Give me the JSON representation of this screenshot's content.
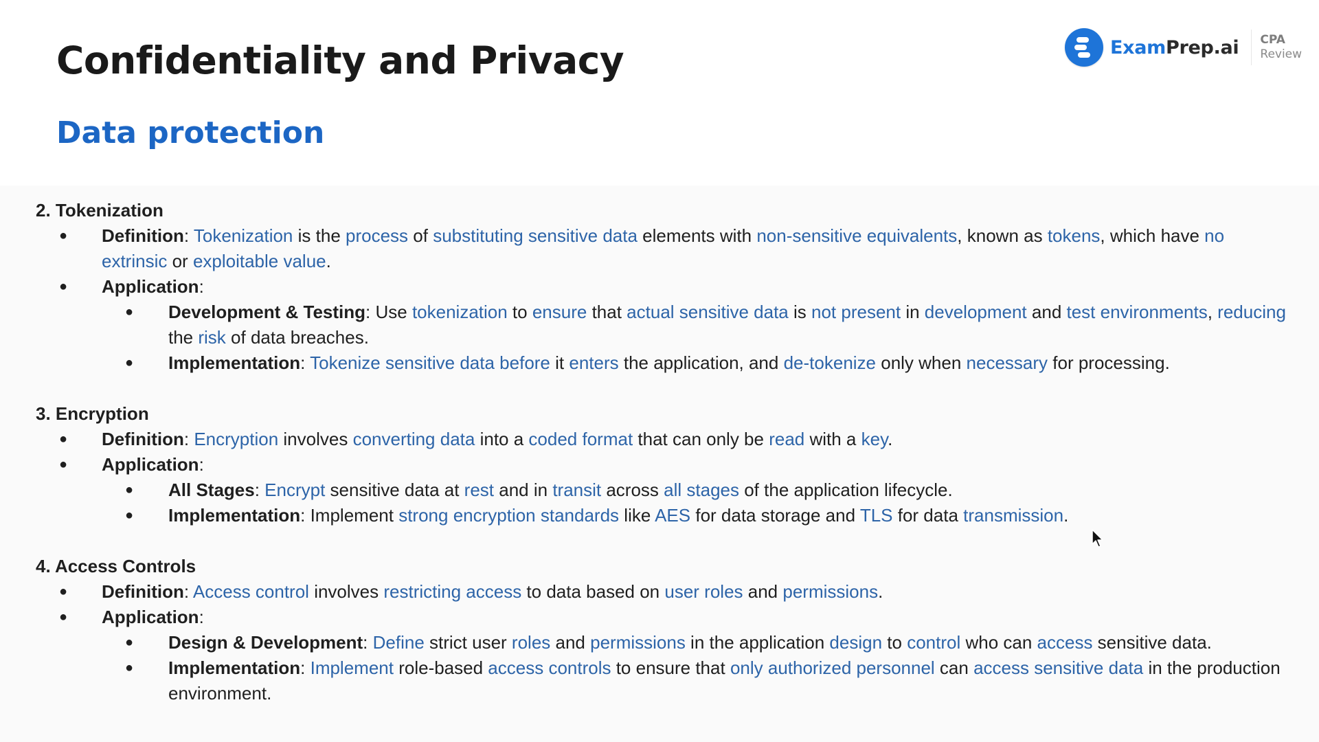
{
  "header": {
    "title": "Confidentiality and Privacy",
    "section": "Data protection"
  },
  "logo": {
    "brand_primary": "Exam",
    "brand_secondary": "Prep.ai",
    "product_line1": "CPA",
    "product_line2": "Review",
    "icon": "exam-prep-logo-icon",
    "brand_color": "#1e74d8"
  },
  "colors": {
    "heading": "#1a1a1a",
    "section_title": "#1c66c4",
    "highlight": "#2d64a8",
    "body_text": "#1f1f1f",
    "content_background": "#fafafa"
  },
  "topics": [
    {
      "heading": "2. Tokenization",
      "items": [
        {
          "label": "Definition",
          "segments": [
            {
              "t": ": ",
              "h": false
            },
            {
              "t": "Tokenization",
              "h": true
            },
            {
              "t": " is the ",
              "h": false
            },
            {
              "t": "process",
              "h": true
            },
            {
              "t": " of ",
              "h": false
            },
            {
              "t": "substituting sensitive data",
              "h": true
            },
            {
              "t": " elements with ",
              "h": false
            },
            {
              "t": "non-sensitive equivalents",
              "h": true
            },
            {
              "t": ", known as ",
              "h": false
            },
            {
              "t": "tokens",
              "h": true
            },
            {
              "t": ", which have ",
              "h": false
            },
            {
              "t": "no extrinsic",
              "h": true
            },
            {
              "t": " or ",
              "h": false
            },
            {
              "t": "exploitable value",
              "h": true
            },
            {
              "t": ".",
              "h": false
            }
          ]
        },
        {
          "label": "Application",
          "segments": [
            {
              "t": ":",
              "h": false
            }
          ],
          "subitems": [
            {
              "label": "Development & Testing",
              "segments": [
                {
                  "t": ": Use ",
                  "h": false
                },
                {
                  "t": "tokenization",
                  "h": true
                },
                {
                  "t": " to ",
                  "h": false
                },
                {
                  "t": "ensure",
                  "h": true
                },
                {
                  "t": " that ",
                  "h": false
                },
                {
                  "t": "actual sensitive data",
                  "h": true
                },
                {
                  "t": " is ",
                  "h": false
                },
                {
                  "t": "not present",
                  "h": true
                },
                {
                  "t": " in ",
                  "h": false
                },
                {
                  "t": "development",
                  "h": true
                },
                {
                  "t": " and ",
                  "h": false
                },
                {
                  "t": "test environments",
                  "h": true
                },
                {
                  "t": ", ",
                  "h": false
                },
                {
                  "t": "reducing",
                  "h": true
                },
                {
                  "t": " the ",
                  "h": false
                },
                {
                  "t": "risk",
                  "h": true
                },
                {
                  "t": " of data breaches.",
                  "h": false
                }
              ]
            },
            {
              "label": "Implementation",
              "segments": [
                {
                  "t": ": ",
                  "h": false
                },
                {
                  "t": "Tokenize sensitive data before",
                  "h": true
                },
                {
                  "t": " it ",
                  "h": false
                },
                {
                  "t": "enters",
                  "h": true
                },
                {
                  "t": " the application, and ",
                  "h": false
                },
                {
                  "t": "de-tokenize",
                  "h": true
                },
                {
                  "t": " only when ",
                  "h": false
                },
                {
                  "t": "necessary",
                  "h": true
                },
                {
                  "t": " for processing.",
                  "h": false
                }
              ]
            }
          ]
        }
      ]
    },
    {
      "heading": "3. Encryption",
      "items": [
        {
          "label": "Definition",
          "segments": [
            {
              "t": ": ",
              "h": false
            },
            {
              "t": "Encryption",
              "h": true
            },
            {
              "t": " involves ",
              "h": false
            },
            {
              "t": "converting data",
              "h": true
            },
            {
              "t": " into a ",
              "h": false
            },
            {
              "t": "coded format",
              "h": true
            },
            {
              "t": " that can only be ",
              "h": false
            },
            {
              "t": "read",
              "h": true
            },
            {
              "t": " with a ",
              "h": false
            },
            {
              "t": "key",
              "h": true
            },
            {
              "t": ".",
              "h": false
            }
          ]
        },
        {
          "label": "Application",
          "segments": [
            {
              "t": ":",
              "h": false
            }
          ],
          "subitems": [
            {
              "label": "All Stages",
              "segments": [
                {
                  "t": ": ",
                  "h": false
                },
                {
                  "t": "Encrypt",
                  "h": true
                },
                {
                  "t": " sensitive data at ",
                  "h": false
                },
                {
                  "t": "rest",
                  "h": true
                },
                {
                  "t": " and in ",
                  "h": false
                },
                {
                  "t": "transit",
                  "h": true
                },
                {
                  "t": " across ",
                  "h": false
                },
                {
                  "t": "all stages",
                  "h": true
                },
                {
                  "t": " of the application lifecycle.",
                  "h": false
                }
              ]
            },
            {
              "label": "Implementation",
              "segments": [
                {
                  "t": ": Implement ",
                  "h": false
                },
                {
                  "t": "strong encryption standards",
                  "h": true
                },
                {
                  "t": " like ",
                  "h": false
                },
                {
                  "t": "AES",
                  "h": true
                },
                {
                  "t": " for data storage and ",
                  "h": false
                },
                {
                  "t": "TLS",
                  "h": true
                },
                {
                  "t": " for data ",
                  "h": false
                },
                {
                  "t": "transmission",
                  "h": true
                },
                {
                  "t": ".",
                  "h": false
                }
              ]
            }
          ]
        }
      ]
    },
    {
      "heading": "4. Access Controls",
      "items": [
        {
          "label": "Definition",
          "segments": [
            {
              "t": ": ",
              "h": false
            },
            {
              "t": "Access control",
              "h": true
            },
            {
              "t": " involves ",
              "h": false
            },
            {
              "t": "restricting access",
              "h": true
            },
            {
              "t": " to data based on ",
              "h": false
            },
            {
              "t": "user roles",
              "h": true
            },
            {
              "t": " and ",
              "h": false
            },
            {
              "t": "permissions",
              "h": true
            },
            {
              "t": ".",
              "h": false
            }
          ]
        },
        {
          "label": "Application",
          "segments": [
            {
              "t": ":",
              "h": false
            }
          ],
          "subitems": [
            {
              "label": "Design & Development",
              "segments": [
                {
                  "t": ": ",
                  "h": false
                },
                {
                  "t": "Define",
                  "h": true
                },
                {
                  "t": " strict user ",
                  "h": false
                },
                {
                  "t": "roles",
                  "h": true
                },
                {
                  "t": " and ",
                  "h": false
                },
                {
                  "t": "permissions",
                  "h": true
                },
                {
                  "t": " in the application ",
                  "h": false
                },
                {
                  "t": "design",
                  "h": true
                },
                {
                  "t": " to ",
                  "h": false
                },
                {
                  "t": "control",
                  "h": true
                },
                {
                  "t": " who can ",
                  "h": false
                },
                {
                  "t": "access",
                  "h": true
                },
                {
                  "t": " sensitive data.",
                  "h": false
                }
              ]
            },
            {
              "label": "Implementation",
              "segments": [
                {
                  "t": ": ",
                  "h": false
                },
                {
                  "t": "Implement",
                  "h": true
                },
                {
                  "t": " role-based ",
                  "h": false
                },
                {
                  "t": "access controls",
                  "h": true
                },
                {
                  "t": " to ensure that ",
                  "h": false
                },
                {
                  "t": "only authorized personnel",
                  "h": true
                },
                {
                  "t": " can ",
                  "h": false
                },
                {
                  "t": "access sensitive data",
                  "h": true
                },
                {
                  "t": " in the production environment.",
                  "h": false
                }
              ]
            }
          ]
        }
      ]
    }
  ],
  "bullet_glyph": "●",
  "cursor": "mouse-pointer-icon"
}
